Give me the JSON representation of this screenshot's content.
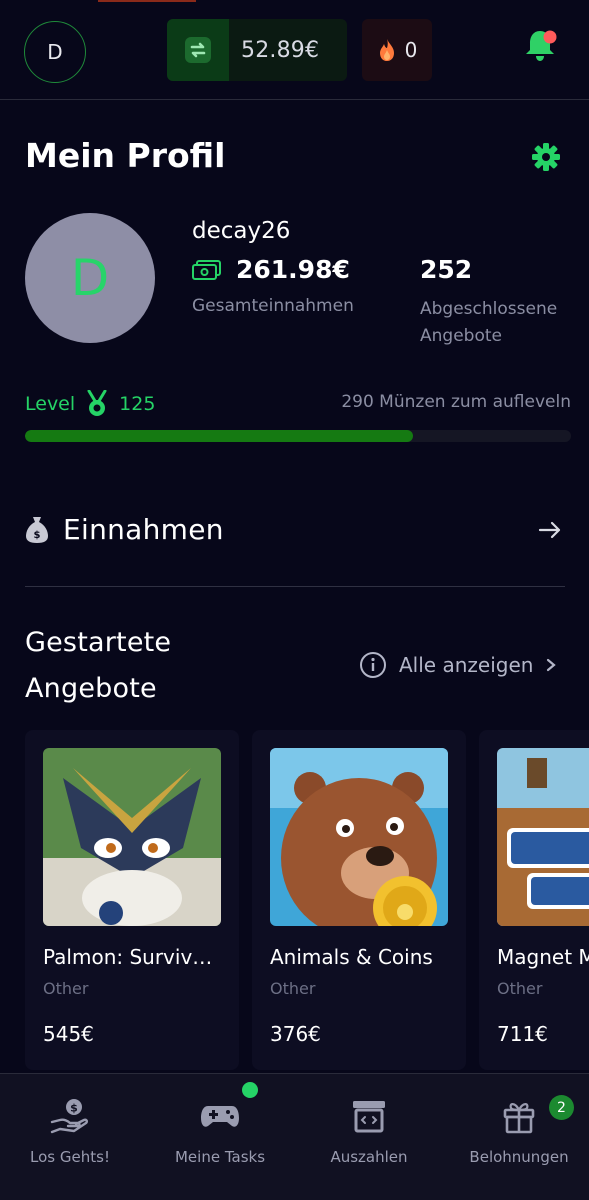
{
  "header": {
    "avatar_initial": "D",
    "balance": "52.89€",
    "streak_count": "0"
  },
  "profile": {
    "title": "Mein Profil",
    "avatar_initial": "D",
    "username": "decay26",
    "total_earnings_value": "261.98€",
    "total_earnings_label": "Gesamteinnahmen",
    "completed_offers_value": "252",
    "completed_offers_label": "Abgeschlossene Angebote",
    "level_label": "Level",
    "level_value": "125",
    "coins_to_level": "290 Münzen zum aufleveln",
    "level_progress": 0.71
  },
  "earnings": {
    "title": "Einnahmen"
  },
  "started_offers": {
    "title": "Gestartete Angebote",
    "show_all": "Alle anzeigen",
    "cards": [
      {
        "name": "Palmon: Surviv…",
        "category": "Other",
        "price": "545€"
      },
      {
        "name": "Animals & Coins",
        "category": "Other",
        "price": "376€"
      },
      {
        "name": "Magnet Miners",
        "category": "Other",
        "price": "711€"
      }
    ]
  },
  "bottom_nav": {
    "items": [
      {
        "label": "Los Gehts!"
      },
      {
        "label": "Meine Tasks"
      },
      {
        "label": "Auszahlen"
      },
      {
        "label": "Belohnungen"
      }
    ],
    "rewards_badge": "2"
  },
  "colors": {
    "background": "#07071a",
    "accent_green": "#25d366",
    "progress_green": "#157a12",
    "muted_text": "#8b8ea3"
  }
}
